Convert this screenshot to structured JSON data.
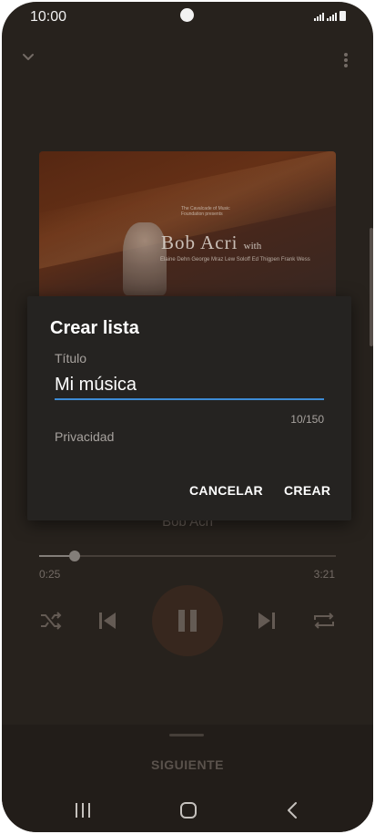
{
  "status_bar": {
    "time": "10:00"
  },
  "player": {
    "album_art": {
      "presenter_text": "The Cavalcade of Music Foundation presents",
      "artist_text": "Bob Acri",
      "with_text": "with",
      "credits_text": "Elaine Dehn  George Mraz  Lew Soloff  Ed Thigpen  Frank Wess"
    },
    "artist": "Bob Acri",
    "elapsed": "0:25",
    "duration": "3:21",
    "progress_fraction": 0.12
  },
  "up_next": {
    "label": "SIGUIENTE"
  },
  "dialog": {
    "title": "Crear lista",
    "title_field_label": "Título",
    "title_value": "Mi música",
    "char_counter": "10/150",
    "privacy_label": "Privacidad",
    "cancel_label": "CANCELAR",
    "create_label": "CREAR"
  },
  "colors": {
    "accent": "#3d8bd5",
    "dialog_bg": "#252321",
    "player_bg": "#2a241f"
  }
}
